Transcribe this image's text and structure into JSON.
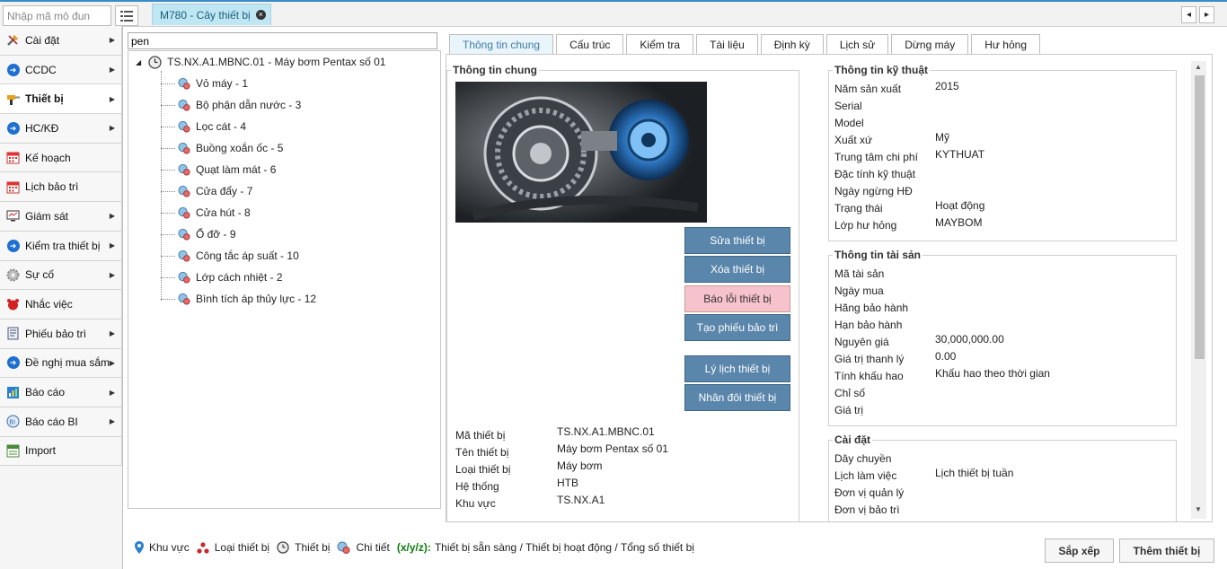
{
  "topbar": {
    "module_placeholder": "Nhập mã mô đun",
    "open_tab": "M780 - Cây thiết bị",
    "close_glyph": "×",
    "prev": "◂",
    "next": "▸"
  },
  "sidebar": {
    "items": [
      {
        "label": "Cài đặt",
        "icon": "tools-icon",
        "arrow": true
      },
      {
        "label": "CCDC",
        "icon": "arrow-circle-icon",
        "arrow": true
      },
      {
        "label": "Thiết bị",
        "icon": "drill-icon",
        "arrow": true,
        "active": true
      },
      {
        "label": "HC/KĐ",
        "icon": "arrow-circle-icon",
        "arrow": true
      },
      {
        "label": "Kế hoạch",
        "icon": "calendar-icon",
        "arrow": false
      },
      {
        "label": "Lịch bảo trì",
        "icon": "calendar-icon",
        "arrow": false
      },
      {
        "label": "Giám sát",
        "icon": "monitor-icon",
        "arrow": true
      },
      {
        "label": "Kiểm tra thiết bị",
        "icon": "arrow-circle-icon",
        "arrow": true
      },
      {
        "label": "Sự cố",
        "icon": "gear-icon",
        "arrow": true
      },
      {
        "label": "Nhắc việc",
        "icon": "alarm-icon",
        "arrow": false
      },
      {
        "label": "Phiếu bảo trì",
        "icon": "form-icon",
        "arrow": true
      },
      {
        "label": "Đề nghị mua sắm",
        "icon": "arrow-circle-icon",
        "arrow": true
      },
      {
        "label": "Báo cáo",
        "icon": "report-icon",
        "arrow": true
      },
      {
        "label": "Báo cáo BI",
        "icon": "bi-icon",
        "arrow": true
      },
      {
        "label": "Import",
        "icon": "import-icon",
        "arrow": false
      }
    ]
  },
  "tree": {
    "search_value": "pen",
    "root": "TS.NX.A1.MBNC.01 - Máy bơm Pentax số 01",
    "children": [
      "Vỏ máy - 1",
      "Bộ phận dẫn nước - 3",
      "Lọc cát - 4",
      "Buồng xoắn ốc - 5",
      "Quạt làm mát - 6",
      "Cửa đẩy - 7",
      "Cửa hút - 8",
      "Ổ đỡ - 9",
      "Công tắc áp suất - 10",
      "Lớp cách nhiệt - 2",
      "Bình tích áp thủy lực - 12"
    ]
  },
  "tabs": [
    "Thông tin chung",
    "Cấu trúc",
    "Kiểm tra",
    "Tài liệu",
    "Định kỳ",
    "Lịch sử",
    "Dừng máy",
    "Hư hỏng"
  ],
  "general": {
    "title": "Thông tin chung",
    "buttons": {
      "edit": "Sửa thiết bị",
      "delete": "Xóa thiết bị",
      "report_error": "Báo lỗi thiết bị",
      "create_ticket": "Tạo phiếu bảo trì",
      "history": "Lý lịch thiết bị",
      "duplicate": "Nhân đôi thiết bị"
    },
    "fields": [
      {
        "label": "Mã thiết bị",
        "value": "TS.NX.A1.MBNC.01"
      },
      {
        "label": "Tên thiết bị",
        "value": "Máy bơm Pentax số 01"
      },
      {
        "label": "Loại thiết bị",
        "value": "Máy bơm"
      },
      {
        "label": "Hệ thống",
        "value": "HTB"
      },
      {
        "label": "Khu vực",
        "value": "TS.NX.A1"
      }
    ]
  },
  "technical": {
    "title": "Thông tin kỹ thuật",
    "fields": [
      {
        "label": "Năm sản xuất",
        "value": "2015"
      },
      {
        "label": "Serial",
        "value": ""
      },
      {
        "label": "Model",
        "value": ""
      },
      {
        "label": "Xuất xứ",
        "value": "Mỹ"
      },
      {
        "label": "Trung tâm chi phí",
        "value": "KYTHUAT"
      },
      {
        "label": "Đặc tính kỹ thuật",
        "value": ""
      },
      {
        "label": "Ngày ngừng HĐ",
        "value": ""
      },
      {
        "label": "Trạng thái",
        "value": "Hoạt động"
      },
      {
        "label": "Lớp hư hỏng",
        "value": "MAYBOM"
      }
    ]
  },
  "asset": {
    "title": "Thông tin tài sản",
    "fields": [
      {
        "label": "Mã tài sản",
        "value": ""
      },
      {
        "label": "Ngày mua",
        "value": ""
      },
      {
        "label": "Hãng bảo hành",
        "value": ""
      },
      {
        "label": "Hạn bảo hành",
        "value": ""
      },
      {
        "label": "Nguyên giá",
        "value": "30,000,000.00"
      },
      {
        "label": "Giá trị thanh lý",
        "value": "0.00"
      },
      {
        "label": "Tính khấu hao",
        "value": "Khấu hao theo thời gian"
      },
      {
        "label": "Chỉ số",
        "value": ""
      },
      {
        "label": "Giá trị",
        "value": ""
      }
    ]
  },
  "settings": {
    "title": "Cài đặt",
    "fields": [
      {
        "label": "Dây chuyền",
        "value": ""
      },
      {
        "label": "Lịch làm việc",
        "value": "Lịch thiết bị tuần"
      },
      {
        "label": "Đơn vị quản lý",
        "value": ""
      },
      {
        "label": "Đơn vị bảo trì",
        "value": ""
      }
    ]
  },
  "footer": {
    "legend": {
      "area": "Khu vực",
      "type": "Loại thiết bị",
      "device": "Thiết bị",
      "detail": "Chi tiết",
      "xyz": "(x/y/z):",
      "xyz_desc": "Thiết bị sẵn sàng / Thiết bị hoạt động / Tổng số thiết bị"
    },
    "sort_button": "Sắp xếp",
    "add_button": "Thêm thiết bị"
  }
}
